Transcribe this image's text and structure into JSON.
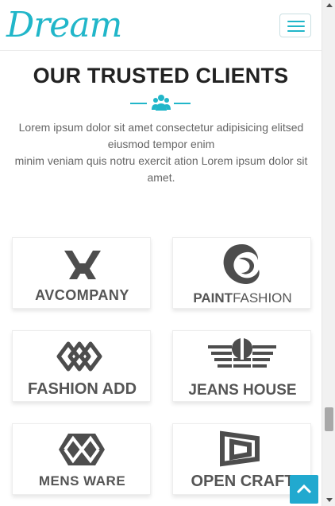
{
  "brand": {
    "logo_text": "Dream",
    "accent": "#21b6c9"
  },
  "nav": {
    "menu_icon": "hamburger-menu-icon"
  },
  "section": {
    "title": "OUR TRUSTED CLIENTS",
    "divider_icon": "users-icon",
    "intro_line1": "Lorem ipsum dolor sit amet consectetur adipisicing elitsed eiusmod tempor enim",
    "intro_line2": "minim veniam quis notru exercit ation Lorem ipsum dolor sit amet."
  },
  "clients": [
    {
      "name_bold": "AVCOMPANY",
      "name_light": ""
    },
    {
      "name_bold": "PAINT",
      "name_light": "FASHION"
    },
    {
      "name_bold": "FASHION ADD",
      "name_light": ""
    },
    {
      "name_bold": "JEANS HOUSE",
      "name_light": ""
    },
    {
      "name_bold": "MENS WARE",
      "name_light": ""
    },
    {
      "name_bold": "OPEN CRAFT",
      "name_light": ""
    }
  ],
  "back_to_top": {
    "icon": "chevron-up-icon"
  }
}
